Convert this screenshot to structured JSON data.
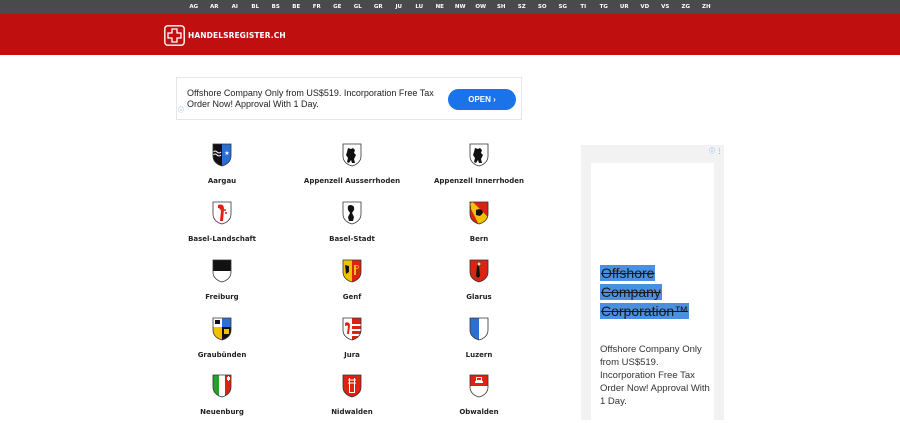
{
  "topnav": [
    "AG",
    "AR",
    "AI",
    "BL",
    "BS",
    "BE",
    "FR",
    "GE",
    "GL",
    "GR",
    "JU",
    "LU",
    "NE",
    "NW",
    "OW",
    "SH",
    "SZ",
    "SO",
    "SG",
    "TI",
    "TG",
    "UR",
    "VD",
    "VS",
    "ZG",
    "ZH"
  ],
  "brand": {
    "name": "HANDELSREGISTER.CH",
    "color": "#c00f0f"
  },
  "ad_top": {
    "text": "Offshore Company Only from US$519. Incorporation Free Tax Order Now! Approval With 1 Day.",
    "button": "OPEN ›"
  },
  "cantons": [
    {
      "name": "Aargau",
      "crest": "aargau"
    },
    {
      "name": "Appenzell Ausserrhoden",
      "crest": "bear"
    },
    {
      "name": "Appenzell Innerrhoden",
      "crest": "bear"
    },
    {
      "name": "Basel-Landschaft",
      "crest": "basel-land"
    },
    {
      "name": "Basel-Stadt",
      "crest": "basel-stadt"
    },
    {
      "name": "Bern",
      "crest": "bern"
    },
    {
      "name": "Freiburg",
      "crest": "freiburg"
    },
    {
      "name": "Genf",
      "crest": "genf"
    },
    {
      "name": "Glarus",
      "crest": "glarus"
    },
    {
      "name": "Graubünden",
      "crest": "graubuenden"
    },
    {
      "name": "Jura",
      "crest": "jura"
    },
    {
      "name": "Luzern",
      "crest": "luzern"
    },
    {
      "name": "Neuenburg",
      "crest": "neuenburg"
    },
    {
      "name": "Nidwalden",
      "crest": "nidwalden"
    },
    {
      "name": "Obwalden",
      "crest": "obwalden"
    }
  ],
  "side_ad": {
    "title": "Offshore Company Corporation™",
    "body": "Offshore Company Only from US$519. Incorporation Free Tax Order Now! Approval With 1 Day."
  }
}
